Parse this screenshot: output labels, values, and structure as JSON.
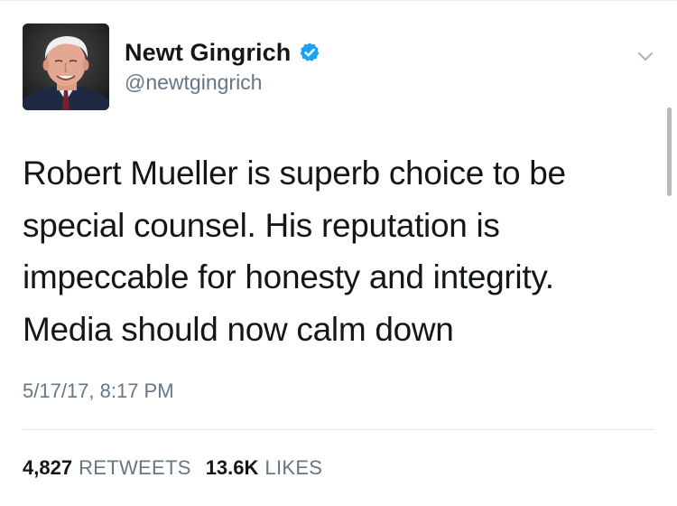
{
  "tweet": {
    "author": {
      "display_name": "Newt Gingrich",
      "handle": "@newtgingrich",
      "verified": true,
      "avatar_icon": "profile-photo"
    },
    "text_lines": [
      "Robert Mueller is superb choice to be",
      "special counsel. His reputation is",
      "impeccable for honesty and integrity.",
      "Media should now calm down"
    ],
    "timestamp": "5/17/17, 8:17 PM",
    "stats": {
      "retweets_count": "4,827",
      "retweets_label": "RETWEETS",
      "likes_count": "13.6K",
      "likes_label": "LIKES"
    },
    "menu_icon": "chevron-down-icon"
  },
  "colors": {
    "verified_blue": "#1da1f2",
    "secondary_text": "#657786",
    "primary_text": "#14171a",
    "divider": "#e1e8ed"
  }
}
